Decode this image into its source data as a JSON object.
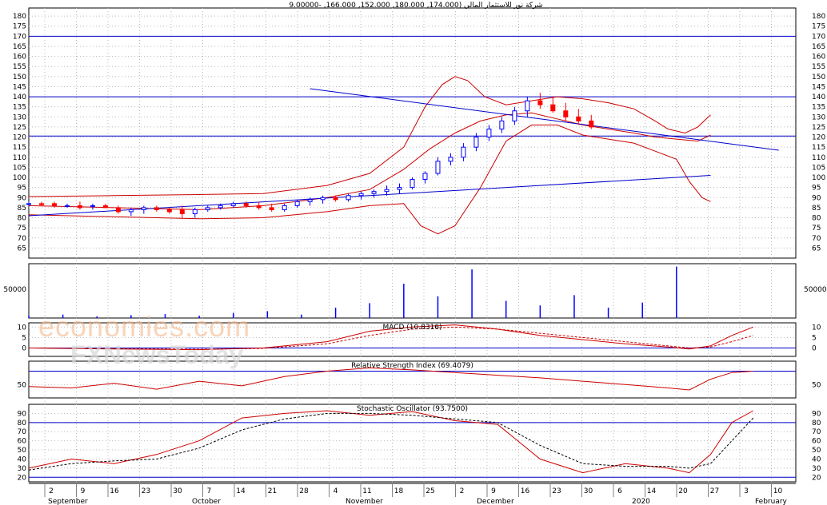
{
  "title": "شركة نور للاستثمار المالي (174.000, 180.000, 152.000, 166.000, -9.00000",
  "watermark": {
    "brand_logo": "economies.com",
    "brand_sub": "FXNewsToday"
  },
  "colors": {
    "grid": "#b8b8b8",
    "up": "#0000ff",
    "down": "#ff0000",
    "band": "#cc0000",
    "trend": "#0000cc",
    "frame": "#000000"
  },
  "x_axis": {
    "day_labels": [
      "2",
      "9",
      "16",
      "23",
      "30",
      "7",
      "14",
      "21",
      "28",
      "4",
      "11",
      "18",
      "25",
      "2",
      "9",
      "16",
      "23",
      "30",
      "6",
      "14",
      "20",
      "27",
      "3",
      "10"
    ],
    "month_labels": [
      "September",
      "October",
      "November",
      "December",
      "2020",
      "February"
    ]
  },
  "chart_data": [
    {
      "type": "candlestick",
      "ylim": [
        60,
        184
      ],
      "yticks": [
        65,
        70,
        75,
        80,
        85,
        90,
        95,
        100,
        105,
        110,
        115,
        120,
        125,
        130,
        135,
        140,
        145,
        150,
        155,
        160,
        165,
        170,
        175,
        180,
        185
      ],
      "horizontal_lines": [
        170,
        140,
        120.5
      ],
      "bollinger": {
        "upper": [
          [
            0,
            90.5
          ],
          [
            20,
            91
          ],
          [
            40,
            91.5
          ],
          [
            55,
            92
          ],
          [
            70,
            96
          ],
          [
            80,
            102
          ],
          [
            88,
            115
          ],
          [
            93,
            135
          ],
          [
            97,
            146
          ],
          [
            100,
            150
          ],
          [
            103,
            148
          ],
          [
            107,
            140
          ],
          [
            112,
            136
          ],
          [
            118,
            138
          ],
          [
            124,
            140
          ],
          [
            130,
            139
          ],
          [
            136,
            137
          ],
          [
            142,
            134
          ],
          [
            147,
            128
          ],
          [
            150,
            124
          ],
          [
            154,
            122
          ],
          [
            157,
            125
          ],
          [
            160,
            131
          ]
        ],
        "middle": [
          [
            0,
            86
          ],
          [
            20,
            85
          ],
          [
            40,
            84
          ],
          [
            55,
            86
          ],
          [
            70,
            90
          ],
          [
            80,
            94
          ],
          [
            88,
            104
          ],
          [
            94,
            114
          ],
          [
            100,
            122
          ],
          [
            106,
            128
          ],
          [
            112,
            131
          ],
          [
            118,
            132
          ],
          [
            124,
            129
          ],
          [
            130,
            126
          ],
          [
            136,
            124
          ],
          [
            142,
            122
          ],
          [
            147,
            120
          ],
          [
            152,
            119
          ],
          [
            157,
            118
          ],
          [
            160,
            121
          ]
        ],
        "lower": [
          [
            0,
            81.5
          ],
          [
            20,
            80.5
          ],
          [
            40,
            79.5
          ],
          [
            55,
            80
          ],
          [
            70,
            83
          ],
          [
            80,
            86
          ],
          [
            88,
            87
          ],
          [
            92,
            76
          ],
          [
            96,
            72
          ],
          [
            100,
            76
          ],
          [
            106,
            95
          ],
          [
            112,
            118
          ],
          [
            118,
            126
          ],
          [
            124,
            126
          ],
          [
            130,
            121
          ],
          [
            136,
            119
          ],
          [
            142,
            117
          ],
          [
            147,
            113
          ],
          [
            152,
            109
          ],
          [
            155,
            98
          ],
          [
            158,
            90
          ],
          [
            160,
            88
          ]
        ]
      },
      "trendlines": [
        {
          "from": [
            66,
            144
          ],
          "to": [
            176,
            113.5
          ]
        },
        {
          "from": [
            0,
            81
          ],
          "to": [
            160,
            101
          ]
        }
      ],
      "candles": [
        [
          0,
          87,
          88,
          86,
          87
        ],
        [
          3,
          87,
          88,
          86,
          86.5
        ],
        [
          6,
          87,
          88,
          85,
          86
        ],
        [
          9,
          86,
          87,
          85,
          86
        ],
        [
          12,
          86,
          88,
          84,
          85
        ],
        [
          15,
          86,
          87,
          84,
          86
        ],
        [
          18,
          86,
          87,
          85,
          85
        ],
        [
          21,
          85,
          86,
          82,
          83
        ],
        [
          24,
          83,
          85,
          81,
          84
        ],
        [
          27,
          84,
          86,
          82,
          85
        ],
        [
          30,
          85,
          86,
          83,
          84
        ],
        [
          33,
          84,
          85,
          82,
          83
        ],
        [
          36,
          84,
          86,
          80,
          82
        ],
        [
          39,
          82,
          85,
          80,
          84
        ],
        [
          42,
          84,
          86,
          83,
          85
        ],
        [
          45,
          85,
          87,
          84,
          86
        ],
        [
          48,
          86,
          88,
          85,
          87
        ],
        [
          51,
          87,
          88,
          85,
          86
        ],
        [
          54,
          86,
          88,
          84,
          85
        ],
        [
          57,
          85,
          87,
          83,
          84
        ],
        [
          60,
          84,
          87,
          83,
          86
        ],
        [
          63,
          86,
          89,
          85,
          88
        ],
        [
          66,
          88,
          90,
          86,
          89
        ],
        [
          69,
          89,
          91,
          87,
          90
        ],
        [
          72,
          90,
          91,
          88,
          89
        ],
        [
          75,
          89,
          92,
          88,
          91
        ],
        [
          78,
          91,
          93,
          89,
          92
        ],
        [
          81,
          92,
          94,
          90,
          93
        ],
        [
          84,
          93,
          96,
          91,
          94
        ],
        [
          87,
          94,
          97,
          92,
          95
        ],
        [
          90,
          95,
          100,
          94,
          99
        ],
        [
          93,
          99,
          103,
          97,
          102
        ],
        [
          96,
          102,
          110,
          101,
          108
        ],
        [
          99,
          108,
          112,
          106,
          110
        ],
        [
          102,
          110,
          117,
          108,
          115
        ],
        [
          105,
          115,
          122,
          113,
          120
        ],
        [
          108,
          120,
          126,
          118,
          124
        ],
        [
          111,
          124,
          130,
          122,
          128
        ],
        [
          114,
          128,
          135,
          126,
          133
        ],
        [
          117,
          133,
          140,
          130,
          138
        ],
        [
          120,
          138,
          142,
          134,
          136
        ],
        [
          123,
          136,
          140,
          132,
          133
        ],
        [
          126,
          133,
          137,
          128,
          130
        ],
        [
          129,
          130,
          134,
          126,
          128
        ],
        [
          132,
          128,
          131,
          124,
          125
        ]
      ],
      "volume": {
        "ylim": [
          0,
          95000
        ],
        "yticks": [
          50000
        ],
        "bars": [
          [
            0,
            4000
          ],
          [
            8,
            6000
          ],
          [
            16,
            3000
          ],
          [
            24,
            5000
          ],
          [
            32,
            7000
          ],
          [
            40,
            4000
          ],
          [
            48,
            9000
          ],
          [
            56,
            12000
          ],
          [
            64,
            6000
          ],
          [
            72,
            18000
          ],
          [
            80,
            26000
          ],
          [
            88,
            60000
          ],
          [
            96,
            38000
          ],
          [
            104,
            85000
          ],
          [
            112,
            30000
          ],
          [
            120,
            22000
          ],
          [
            128,
            40000
          ],
          [
            136,
            18000
          ],
          [
            144,
            27000
          ],
          [
            152,
            90000
          ]
        ]
      }
    },
    {
      "type": "line",
      "name": "MACD (10.8316)",
      "ylim": [
        -4,
        12
      ],
      "yticks": [
        0,
        5,
        10
      ],
      "series": [
        {
          "values": [
            [
              0,
              0
            ],
            [
              20,
              -0.5
            ],
            [
              40,
              -0.8
            ],
            [
              55,
              0
            ],
            [
              70,
              3
            ],
            [
              80,
              8
            ],
            [
              90,
              10
            ],
            [
              100,
              11
            ],
            [
              110,
              9
            ],
            [
              120,
              6
            ],
            [
              130,
              4
            ],
            [
              140,
              2
            ],
            [
              150,
              0.5
            ],
            [
              155,
              -0.5
            ],
            [
              160,
              1
            ],
            [
              165,
              6
            ],
            [
              170,
              10
            ]
          ]
        },
        {
          "values": [
            [
              0,
              0
            ],
            [
              20,
              -0.3
            ],
            [
              40,
              -0.6
            ],
            [
              55,
              -0.2
            ],
            [
              70,
              2
            ],
            [
              80,
              6
            ],
            [
              90,
              9
            ],
            [
              100,
              10
            ],
            [
              110,
              9
            ],
            [
              120,
              7
            ],
            [
              130,
              5
            ],
            [
              140,
              3
            ],
            [
              150,
              1
            ],
            [
              155,
              0
            ],
            [
              160,
              0.5
            ],
            [
              165,
              3
            ],
            [
              170,
              6
            ]
          ]
        }
      ]
    },
    {
      "type": "line",
      "name": "Relative Strength Index (69.4079)",
      "ylim": [
        30,
        85
      ],
      "yticks": [
        50
      ],
      "horizontal_lines": [
        70
      ],
      "series": [
        {
          "values": [
            [
              0,
              47
            ],
            [
              10,
              45
            ],
            [
              20,
              52
            ],
            [
              30,
              43
            ],
            [
              40,
              55
            ],
            [
              50,
              48
            ],
            [
              60,
              62
            ],
            [
              70,
              70
            ],
            [
              80,
              75
            ],
            [
              90,
              72
            ],
            [
              100,
              68
            ],
            [
              110,
              64
            ],
            [
              120,
              60
            ],
            [
              130,
              55
            ],
            [
              140,
              50
            ],
            [
              150,
              45
            ],
            [
              155,
              42
            ],
            [
              160,
              58
            ],
            [
              165,
              68
            ],
            [
              170,
              70
            ]
          ]
        }
      ]
    },
    {
      "type": "line",
      "name": "Stochastic Oscillator (93.7500)",
      "ylim": [
        15,
        100
      ],
      "yticks": [
        20,
        30,
        40,
        50,
        60,
        70,
        80,
        90
      ],
      "horizontal_lines": [
        80,
        20
      ],
      "series": [
        {
          "values": [
            [
              0,
              30
            ],
            [
              10,
              40
            ],
            [
              20,
              35
            ],
            [
              30,
              45
            ],
            [
              40,
              60
            ],
            [
              50,
              85
            ],
            [
              60,
              90
            ],
            [
              70,
              93
            ],
            [
              80,
              88
            ],
            [
              90,
              92
            ],
            [
              100,
              82
            ],
            [
              110,
              78
            ],
            [
              120,
              40
            ],
            [
              130,
              25
            ],
            [
              140,
              35
            ],
            [
              150,
              30
            ],
            [
              155,
              25
            ],
            [
              160,
              45
            ],
            [
              165,
              80
            ],
            [
              170,
              93
            ]
          ]
        },
        {
          "values": [
            [
              0,
              28
            ],
            [
              10,
              35
            ],
            [
              20,
              38
            ],
            [
              30,
              40
            ],
            [
              40,
              52
            ],
            [
              50,
              72
            ],
            [
              60,
              84
            ],
            [
              70,
              90
            ],
            [
              80,
              90
            ],
            [
              90,
              88
            ],
            [
              100,
              84
            ],
            [
              110,
              80
            ],
            [
              120,
              55
            ],
            [
              130,
              35
            ],
            [
              140,
              32
            ],
            [
              150,
              32
            ],
            [
              155,
              30
            ],
            [
              160,
              35
            ],
            [
              165,
              60
            ],
            [
              170,
              85
            ]
          ]
        }
      ]
    }
  ]
}
